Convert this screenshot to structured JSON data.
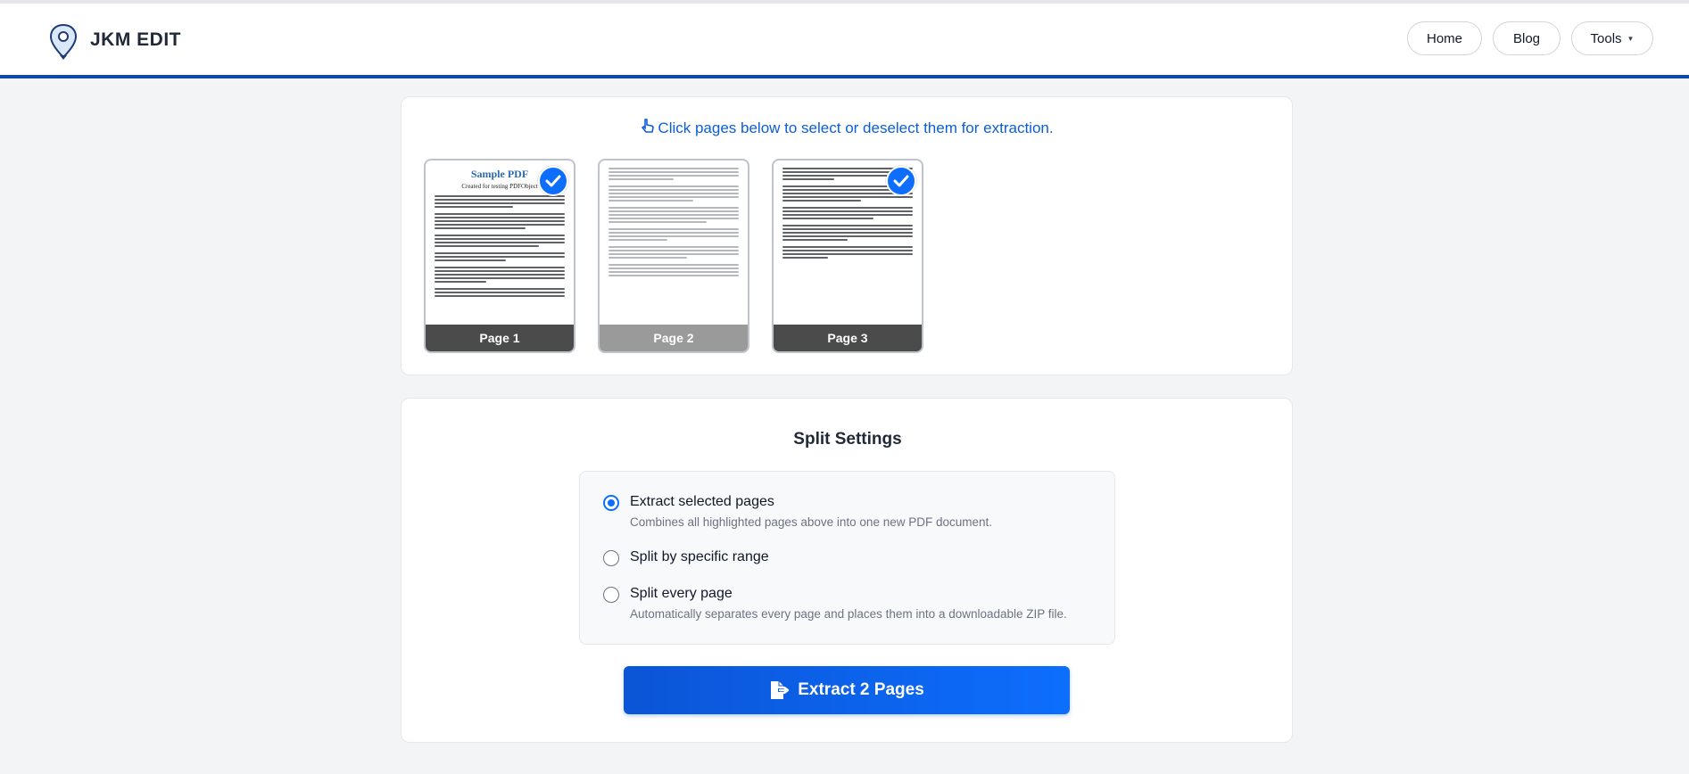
{
  "header": {
    "brand": "JKM EDIT",
    "nav": {
      "home": "Home",
      "blog": "Blog",
      "tools": "Tools"
    }
  },
  "pages_panel": {
    "instruction": "Click pages below to select or deselect them for extraction.",
    "pages": [
      {
        "label": "Page 1",
        "selected": true,
        "title": "Sample PDF",
        "subtitle": "Created for testing PDFObject"
      },
      {
        "label": "Page 2",
        "selected": false
      },
      {
        "label": "Page 3",
        "selected": true
      }
    ]
  },
  "settings": {
    "title": "Split Settings",
    "options": [
      {
        "label": "Extract selected pages",
        "description": "Combines all highlighted pages above into one new PDF document.",
        "checked": true
      },
      {
        "label": "Split by specific range",
        "description": "",
        "checked": false
      },
      {
        "label": "Split every page",
        "description": "Automatically separates every page and places them into a downloadable ZIP file.",
        "checked": false
      }
    ],
    "action_button": "Extract 2 Pages"
  },
  "colors": {
    "accent": "#0d6efd",
    "header_border": "#0b48a8",
    "instruction": "#0b5ed7"
  }
}
